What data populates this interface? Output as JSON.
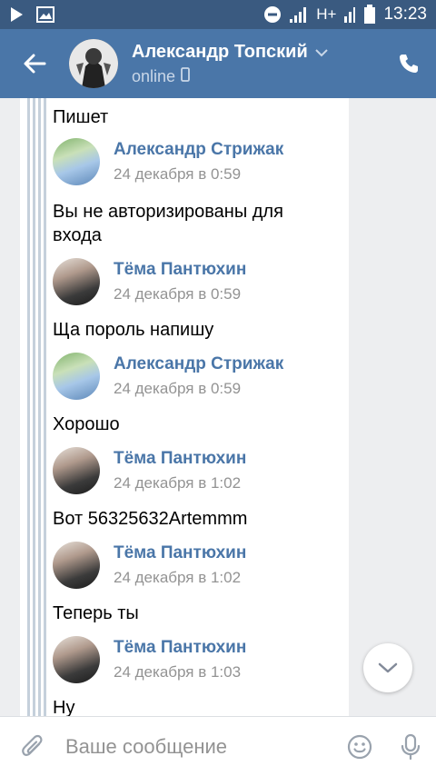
{
  "status_bar": {
    "network": "H+",
    "time": "13:23"
  },
  "header": {
    "name": "Александр Топский",
    "status": "online"
  },
  "messages": [
    {
      "text": "Пишет"
    },
    {
      "author": "Александр Стрижак",
      "date": "24 декабря в 0:59",
      "avatar": "avatar-aleksandr"
    },
    {
      "text": "Вы не авторизированы для входа"
    },
    {
      "author": "Тёма Пантюхин",
      "date": "24 декабря в 0:59",
      "avatar": "avatar-tema"
    },
    {
      "text": "Ща пороль напишу"
    },
    {
      "author": "Александр Стрижак",
      "date": "24 декабря в 0:59",
      "avatar": "avatar-aleksandr"
    },
    {
      "text": "Хорошо"
    },
    {
      "author": "Тёма Пантюхин",
      "date": "24 декабря в 1:02",
      "avatar": "avatar-tema"
    },
    {
      "text": "Вот 56325632Artemmm"
    },
    {
      "author": "Тёма Пантюхин",
      "date": "24 декабря в 1:02",
      "avatar": "avatar-tema"
    },
    {
      "text": "Теперь ты"
    },
    {
      "author": "Тёма Пантюхин",
      "date": "24 декабря в 1:03",
      "avatar": "avatar-tema"
    },
    {
      "text": "Ну"
    }
  ],
  "composer": {
    "placeholder": "Ваше сообщение"
  },
  "colors": {
    "header": "#4a76a8",
    "status_bar": "#3a5a80",
    "link": "#4a76a8",
    "muted": "#939393"
  }
}
